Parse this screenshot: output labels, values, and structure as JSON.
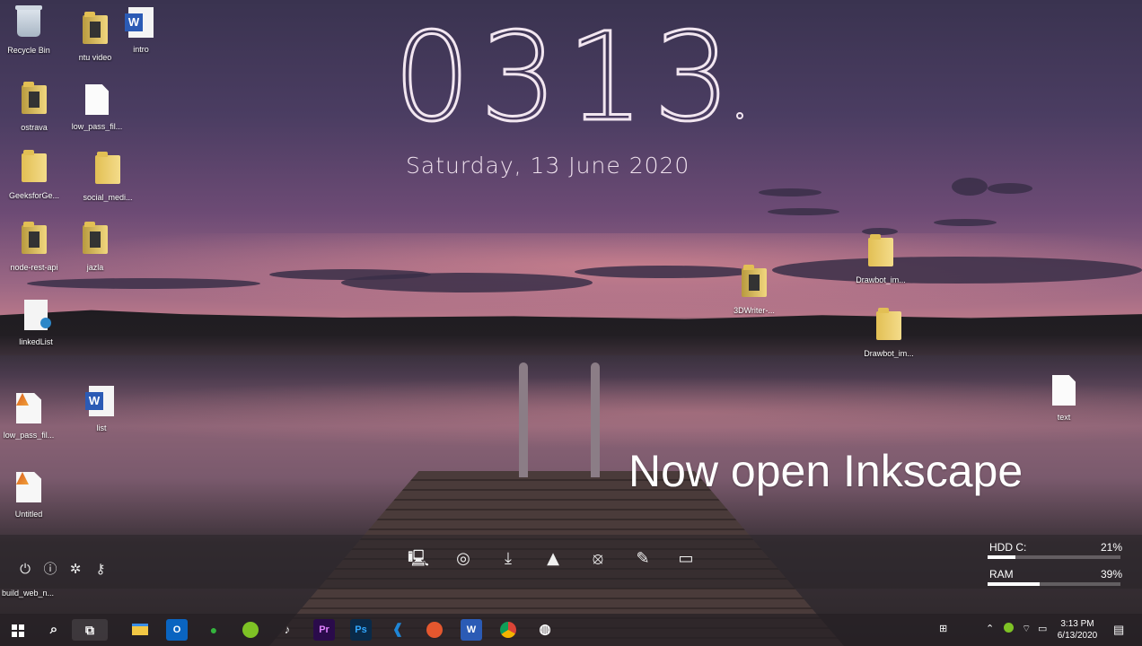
{
  "wallpaper": {
    "clock_time": "0313",
    "date_line": "Saturday, 13  June  2020",
    "caption": "Now open Inkscape"
  },
  "desktop_icons": [
    {
      "label": "Recycle Bin",
      "icon": "recycle-bin-icon"
    },
    {
      "label": "ntu video",
      "icon": "folder-icon"
    },
    {
      "label": "intro",
      "icon": "word-document-icon"
    },
    {
      "label": "ostrava",
      "icon": "folder-icon"
    },
    {
      "label": "low_pass_fil...",
      "icon": "blank-file-icon"
    },
    {
      "label": "GeeksforGe...",
      "icon": "folder-icon"
    },
    {
      "label": "social_medi...",
      "icon": "folder-icon"
    },
    {
      "label": "node-rest-api",
      "icon": "folder-icon"
    },
    {
      "label": "jazla",
      "icon": "folder-icon"
    },
    {
      "label": "linkedList",
      "icon": "c-source-file-icon"
    },
    {
      "label": "low_pass_fil...",
      "icon": "matlab-file-icon"
    },
    {
      "label": "list",
      "icon": "word-document-icon"
    },
    {
      "label": "Untitled",
      "icon": "matlab-file-icon"
    },
    {
      "label": "3DWriter-...",
      "icon": "folder-icon"
    },
    {
      "label": "Drawbot_im...",
      "icon": "folder-icon"
    },
    {
      "label": "Drawbot_im...",
      "icon": "folder-icon"
    },
    {
      "label": "text",
      "icon": "text-file-icon"
    }
  ],
  "launcher": {
    "left_buttons": [
      "power-icon",
      "info-icon",
      "settings-icon",
      "wrench-icon"
    ],
    "dock_icons": [
      "my-computer-icon",
      "chrome-icon",
      "download-icon",
      "vlc-icon",
      "camera-icon",
      "notepad-icon",
      "terminal-icon"
    ],
    "build_label": "build_web_n..."
  },
  "stats": {
    "hdd_label": "HDD C:",
    "hdd_value": "21%",
    "hdd_fraction": 0.21,
    "ram_label": "RAM",
    "ram_value": "39%",
    "ram_fraction": 0.39
  },
  "taskbar": {
    "apps": [
      {
        "name": "file-explorer",
        "text": ""
      },
      {
        "name": "outlook",
        "text": "O"
      },
      {
        "name": "wechat",
        "text": ""
      },
      {
        "name": "green-app",
        "text": ""
      },
      {
        "name": "media-app",
        "text": ""
      },
      {
        "name": "premiere",
        "text": "Pr"
      },
      {
        "name": "photoshop",
        "text": "Ps"
      },
      {
        "name": "vscode",
        "text": ""
      },
      {
        "name": "swift-app",
        "text": ""
      },
      {
        "name": "word",
        "text": "W"
      },
      {
        "name": "chrome",
        "text": ""
      },
      {
        "name": "obs",
        "text": ""
      }
    ],
    "time": "3:13 PM",
    "date": "6/13/2020"
  },
  "colors": {
    "outlook": "#0a64c0",
    "wechat": "#34b33d",
    "premiere": "#2a0b4b",
    "premiere_text": "#e083ff",
    "photoshop": "#0a2a48",
    "photoshop_text": "#32a8ff",
    "vscode": "#1f86d6",
    "word": "#2b5bb5"
  }
}
